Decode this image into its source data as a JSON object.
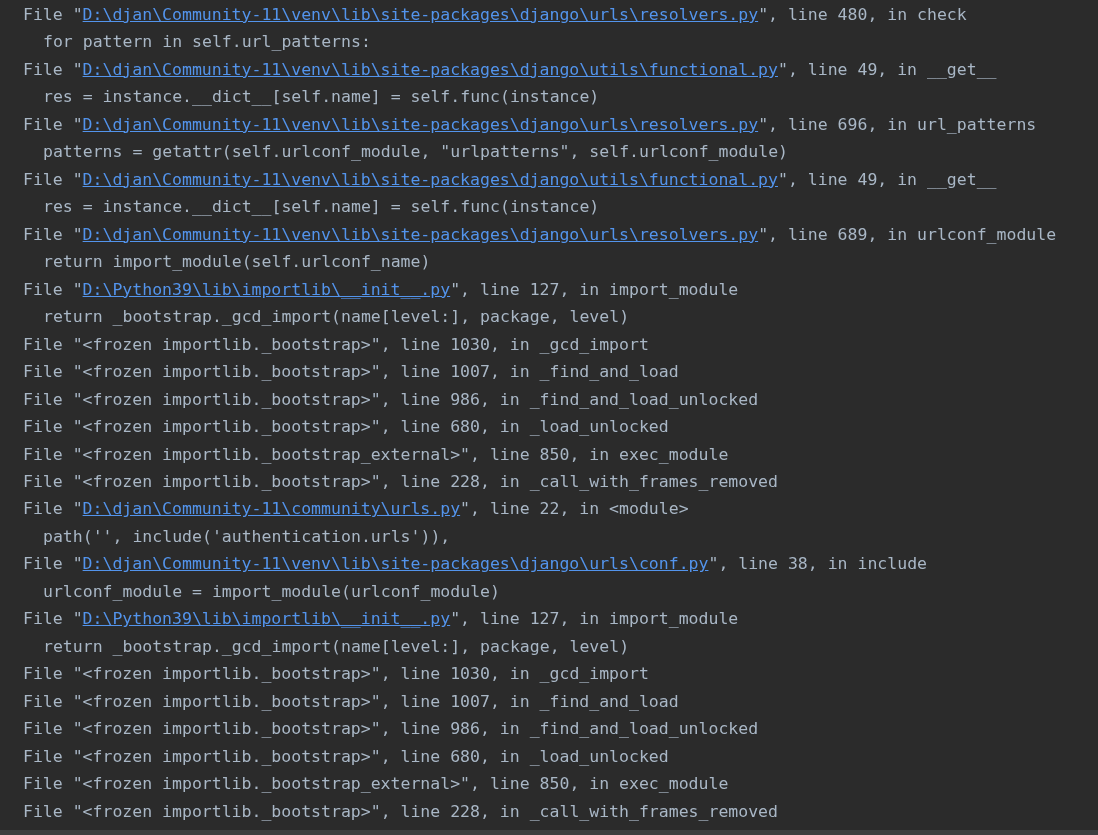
{
  "console": {
    "lines": [
      {
        "kind": "frame",
        "before": "File \"",
        "path": "D:\\djan\\Community-11\\venv\\lib\\site-packages\\django\\urls\\resolvers.py",
        "link": true,
        "after": "\", line 480, in check"
      },
      {
        "kind": "code",
        "text": "for pattern in self.url_patterns:"
      },
      {
        "kind": "frame",
        "before": "File \"",
        "path": "D:\\djan\\Community-11\\venv\\lib\\site-packages\\django\\utils\\functional.py",
        "link": true,
        "after": "\", line 49, in __get__"
      },
      {
        "kind": "code",
        "text": "res = instance.__dict__[self.name] = self.func(instance)"
      },
      {
        "kind": "frame",
        "before": "File \"",
        "path": "D:\\djan\\Community-11\\venv\\lib\\site-packages\\django\\urls\\resolvers.py",
        "link": true,
        "after": "\", line 696, in url_patterns"
      },
      {
        "kind": "code",
        "text": "patterns = getattr(self.urlconf_module, \"urlpatterns\", self.urlconf_module)"
      },
      {
        "kind": "frame",
        "before": "File \"",
        "path": "D:\\djan\\Community-11\\venv\\lib\\site-packages\\django\\utils\\functional.py",
        "link": true,
        "after": "\", line 49, in __get__"
      },
      {
        "kind": "code",
        "text": "res = instance.__dict__[self.name] = self.func(instance)"
      },
      {
        "kind": "frame",
        "before": "File \"",
        "path": "D:\\djan\\Community-11\\venv\\lib\\site-packages\\django\\urls\\resolvers.py",
        "link": true,
        "after": "\", line 689, in urlconf_module"
      },
      {
        "kind": "code",
        "text": "return import_module(self.urlconf_name)"
      },
      {
        "kind": "frame",
        "before": "File \"",
        "path": "D:\\Python39\\lib\\importlib\\__init__.py",
        "link": true,
        "after": "\", line 127, in import_module"
      },
      {
        "kind": "code",
        "text": "return _bootstrap._gcd_import(name[level:], package, level)"
      },
      {
        "kind": "frame",
        "before": "File \"",
        "path": "<frozen importlib._bootstrap>",
        "link": false,
        "after": "\", line 1030, in _gcd_import"
      },
      {
        "kind": "frame",
        "before": "File \"",
        "path": "<frozen importlib._bootstrap>",
        "link": false,
        "after": "\", line 1007, in _find_and_load"
      },
      {
        "kind": "frame",
        "before": "File \"",
        "path": "<frozen importlib._bootstrap>",
        "link": false,
        "after": "\", line 986, in _find_and_load_unlocked"
      },
      {
        "kind": "frame",
        "before": "File \"",
        "path": "<frozen importlib._bootstrap>",
        "link": false,
        "after": "\", line 680, in _load_unlocked"
      },
      {
        "kind": "frame",
        "before": "File \"",
        "path": "<frozen importlib._bootstrap_external>",
        "link": false,
        "after": "\", line 850, in exec_module"
      },
      {
        "kind": "frame",
        "before": "File \"",
        "path": "<frozen importlib._bootstrap>",
        "link": false,
        "after": "\", line 228, in _call_with_frames_removed"
      },
      {
        "kind": "frame",
        "before": "File \"",
        "path": "D:\\djan\\Community-11\\community\\urls.py",
        "link": true,
        "after": "\", line 22, in <module>"
      },
      {
        "kind": "code",
        "text": "path('', include('authentication.urls')),"
      },
      {
        "kind": "frame",
        "before": "File \"",
        "path": "D:\\djan\\Community-11\\venv\\lib\\site-packages\\django\\urls\\conf.py",
        "link": true,
        "after": "\", line 38, in include"
      },
      {
        "kind": "code",
        "text": "urlconf_module = import_module(urlconf_module)"
      },
      {
        "kind": "frame",
        "before": "File \"",
        "path": "D:\\Python39\\lib\\importlib\\__init__.py",
        "link": true,
        "after": "\", line 127, in import_module"
      },
      {
        "kind": "code",
        "text": "return _bootstrap._gcd_import(name[level:], package, level)"
      },
      {
        "kind": "frame",
        "before": "File \"",
        "path": "<frozen importlib._bootstrap>",
        "link": false,
        "after": "\", line 1030, in _gcd_import"
      },
      {
        "kind": "frame",
        "before": "File \"",
        "path": "<frozen importlib._bootstrap>",
        "link": false,
        "after": "\", line 1007, in _find_and_load"
      },
      {
        "kind": "frame",
        "before": "File \"",
        "path": "<frozen importlib._bootstrap>",
        "link": false,
        "after": "\", line 986, in _find_and_load_unlocked"
      },
      {
        "kind": "frame",
        "before": "File \"",
        "path": "<frozen importlib._bootstrap>",
        "link": false,
        "after": "\", line 680, in _load_unlocked"
      },
      {
        "kind": "frame",
        "before": "File \"",
        "path": "<frozen importlib._bootstrap_external>",
        "link": false,
        "after": "\", line 850, in exec_module"
      },
      {
        "kind": "frame",
        "before": "File \"",
        "path": "<frozen importlib._bootstrap>",
        "link": false,
        "after": "\", line 228, in _call_with_frames_removed"
      }
    ]
  }
}
